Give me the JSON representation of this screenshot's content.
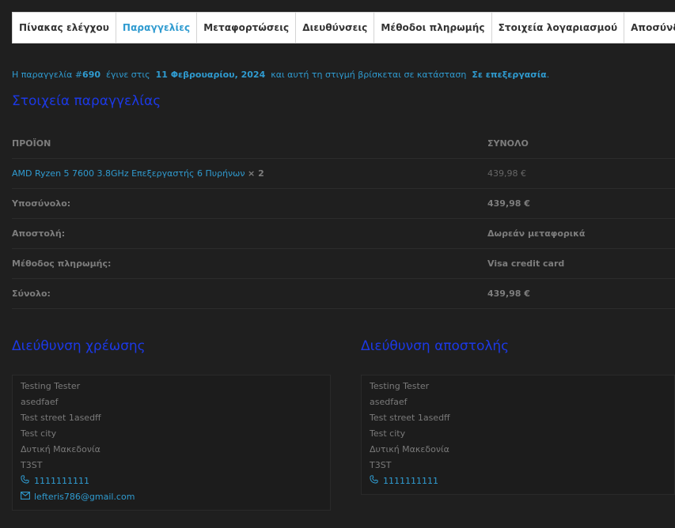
{
  "tabs": [
    {
      "label": "Πίνακας ελέγχου",
      "active": false
    },
    {
      "label": "Παραγγελίες",
      "active": true
    },
    {
      "label": "Μεταφορτώσεις",
      "active": false
    },
    {
      "label": "Διευθύνσεις",
      "active": false
    },
    {
      "label": "Μέθοδοι πληρωμής",
      "active": false
    },
    {
      "label": "Στοιχεία λογαριασμού",
      "active": false
    },
    {
      "label": "Αποσύνδεση",
      "active": false
    }
  ],
  "notice": {
    "prefix": "Η παραγγελία #",
    "order_number": "690",
    "mid1": "έγινε στις",
    "date": "11 Φεβρουαρίου, 2024",
    "mid2": "και αυτή τη στιγμή βρίσκεται σε κατάσταση",
    "status": "Σε επεξεργασία",
    "suffix": "."
  },
  "order_details": {
    "heading": "Στοιχεία παραγγελίας",
    "col_product": "ΠΡΟΪΟΝ",
    "col_total": "ΣΥΝΟΛΟ",
    "item": {
      "name": "AMD Ryzen 5 7600 3.8GHz Επεξεργαστής 6 Πυρήνων",
      "qty": "× 2",
      "price": "439,98 €"
    },
    "totals": [
      {
        "label": "Υποσύνολο:",
        "value": "439,98 €"
      },
      {
        "label": "Αποστολή:",
        "value": "Δωρεάν μεταφορικά"
      },
      {
        "label": "Μέθοδος πληρωμής:",
        "value": "Visa credit card"
      },
      {
        "label": "Σύνολο:",
        "value": "439,98 €"
      }
    ]
  },
  "billing": {
    "heading": "Διεύθυνση χρέωσης",
    "lines": [
      "Testing Tester",
      "asedfaef",
      "Test street 1asedff",
      "Test city",
      "Δυτική Μακεδονία",
      "T3ST"
    ],
    "phone": "1111111111",
    "email": "lefteris786@gmail.com"
  },
  "shipping": {
    "heading": "Διεύθυνση αποστολής",
    "lines": [
      "Testing Tester",
      "asedfaef",
      "Test street 1asedff",
      "Test city",
      "Δυτική Μακεδονία",
      "T3ST"
    ],
    "phone": "1111111111"
  },
  "icons": {
    "phone": "phone-icon",
    "email": "envelope-icon"
  },
  "colors": {
    "accent": "#2f9bd0",
    "heading": "#1c39e6",
    "background": "#1f1f1f"
  }
}
